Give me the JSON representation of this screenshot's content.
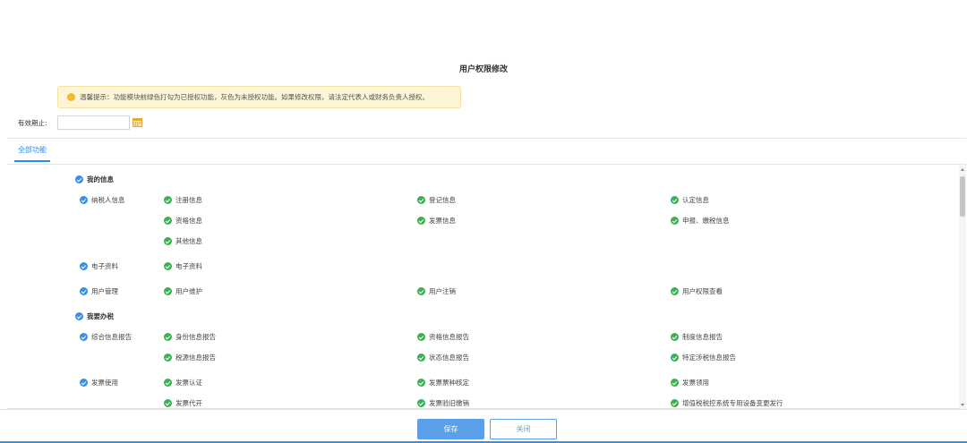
{
  "dialog": {
    "title": "用户权限修改"
  },
  "tip": {
    "text": "温馨提示：功能模块前绿色打勾为已授权功能，灰色为未授权功能。如果修改权限，请法定代表人或财务负责人授权。"
  },
  "validity": {
    "label": "有效期止:",
    "value": ""
  },
  "tabs": {
    "all_label": "全部功能"
  },
  "permissions": {
    "group_my_info": "我的信息",
    "taxpayer_info": "纳税人信息",
    "register_info": "注册信息",
    "registration_info": "登记信息",
    "certification_info": "认定信息",
    "qualification_info": "资格信息",
    "invoice_info": "发票信息",
    "declare_info": "申报、缴税信息",
    "other_info": "其他信息",
    "e_docs": "电子资料",
    "e_docs_item": "电子资料",
    "user_mgmt": "用户管理",
    "user_maintain": "用户维护",
    "user_cancel": "用户注销",
    "user_perm_view": "用户权限查看",
    "group_tax": "我要办税",
    "report": "综合信息报告",
    "identity_report": "身份信息报告",
    "qualification_report": "资格信息报告",
    "system_report": "制度信息报告",
    "tax_source_report": "税源信息报告",
    "status_report": "状态信息报告",
    "special_report": "特定涉税信息报告",
    "invoice_use": "发票使用",
    "invoice_auth": "发票认证",
    "invoice_kind": "发票票种核定",
    "invoice_receive": "发票领用",
    "invoice_issue": "发票代开",
    "invoice_cancel": "发票验旧缴销",
    "vat_device": "增值税税控系统专用设备变更发行"
  },
  "buttons": {
    "save": "保存",
    "close": "关闭"
  },
  "colors": {
    "accent": "#3a8ee6",
    "checked": "#3cb054",
    "tip_bg": "#fdf5d6"
  }
}
